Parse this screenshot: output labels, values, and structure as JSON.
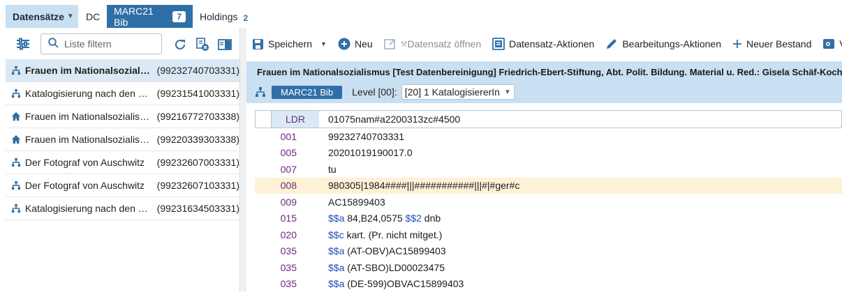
{
  "tabs": {
    "records_label": "Datensätze",
    "dc_label": "DC",
    "marc_label": "MARC21 Bib",
    "marc_badge": "7",
    "holdings_label": "Holdings",
    "holdings_count": "2"
  },
  "left": {
    "filter_placeholder": "Liste filtern",
    "records": [
      {
        "title": "Frauen im Nationalsozialismus",
        "id": "(99232740703331)",
        "icon": "hierarchy-icon",
        "selected": true
      },
      {
        "title": "Katalogisierung nach den Regeln",
        "id": "(99231541003331)",
        "icon": "hierarchy-icon",
        "selected": false
      },
      {
        "title": "Frauen im Nationalsozialismus",
        "id": "(99216772703338)",
        "icon": "home-icon",
        "selected": false
      },
      {
        "title": "Frauen im Nationalsozialismus",
        "id": "(99220339303338)",
        "icon": "home-icon",
        "selected": false
      },
      {
        "title": "Der Fotograf von Auschwitz",
        "id": "(99232607003331)",
        "icon": "hierarchy-icon",
        "selected": false
      },
      {
        "title": "Der Fotograf von Auschwitz",
        "id": "(99232607103331)",
        "icon": "hierarchy-icon",
        "selected": false
      },
      {
        "title": "Katalogisierung nach den Regeln",
        "id": "(99231634503331)",
        "icon": "hierarchy-icon",
        "selected": false
      }
    ]
  },
  "actions": {
    "save": "Speichern",
    "new": "Neu",
    "open_record": "Datensatz öffnen",
    "record_actions": "Datensatz-Aktionen",
    "edit_actions": "Bearbeitungs-Aktionen",
    "new_holding": "Neuer Bestand",
    "truncated": "Ve"
  },
  "header": {
    "title": "Frauen im Nationalsozialismus [Test Datenbereinigung] Friedrich-Ebert-Stiftung, Abt. Polit. Bildung. Material u. Red.: Gisela Schäf-Koch",
    "marc_pill": "MARC21 Bib",
    "level_label": "Level [00]:",
    "level_value": "[20] 1 KatalogisiererIn"
  },
  "marc": {
    "ldr": {
      "tag": "LDR",
      "value": "01075nam#a2200313zc#4500"
    },
    "rows": [
      {
        "tag": "001",
        "value": "99232740703331"
      },
      {
        "tag": "005",
        "value": "20201019190017.0"
      },
      {
        "tag": "007",
        "value": "tu"
      },
      {
        "tag": "008",
        "value": "980305|1984####|||###########|||#|#ger#c"
      },
      {
        "tag": "009",
        "value": "AC15899403"
      },
      {
        "tag": "015",
        "sub1": "$$a",
        "text1": " 84,B24,0575 ",
        "sub2": "$$2",
        "text2": " dnb"
      },
      {
        "tag": "020",
        "sub1": "$$c",
        "text1": " kart. (Pr. nicht mitget.)"
      },
      {
        "tag": "035",
        "sub1": "$$a",
        "text1": " (AT-OBV)AC15899403"
      },
      {
        "tag": "035",
        "sub1": "$$a",
        "text1": " (AT-SBO)LD00023475"
      },
      {
        "tag": "035",
        "sub1": "$$a",
        "text1": " (DE-599)OBVAC15899403"
      }
    ]
  }
}
